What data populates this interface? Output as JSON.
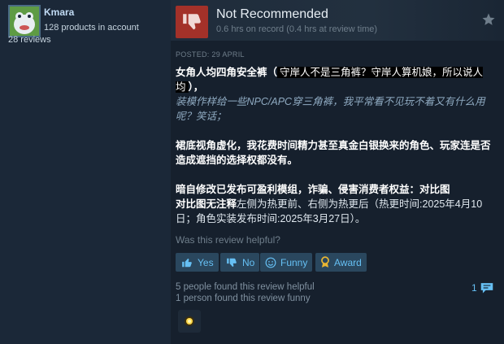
{
  "author": {
    "name": "Kmara",
    "products": "128 products in account",
    "reviews": "28 reviews"
  },
  "review": {
    "verdict": "Not Recommended",
    "hours": "0.6 hrs on record (0.4 hrs at review time)",
    "posted": "POSTED: 29 APRIL",
    "p1_a": "女角人均四角安全裤（",
    "p1_spoiler": "守岸人不是三角裤？守岸人算机娘，所以说人均",
    "p1_b": "），",
    "p2": "装模作样给一些NPC/APC穿三角裤，我平常看不见玩不着又有什么用呢？笑话；",
    "p3": "裙底视角虚化，我花费时间精力甚至真金白银换来的角色、玩家连是否造成遮挡的选择权都没有。",
    "p4_bold": "暗自修改已发布可盈利模组，诈骗、侵害消费者权益：对比图\n对比图无注释",
    "p4_rest": "左侧为热更前、右侧为热更后（热更时间:2025年4月10日；角色实装发布时间:2025年3月27日）。"
  },
  "feedback": {
    "question": "Was this review helpful?",
    "yes_label": "Yes",
    "no_label": "No",
    "funny_label": "Funny",
    "award_label": "Award",
    "helpful_stat": "5 people found this review helpful",
    "funny_stat": "1 person found this review funny",
    "comment_count": "1"
  },
  "icons": {
    "verdict": "thumbs-down-icon",
    "star": "star-icon",
    "yes": "thumbs-up-icon",
    "no": "thumbs-down-icon",
    "funny": "smiley-icon",
    "award": "award-icon",
    "comment": "comment-icon"
  },
  "colors": {
    "accent": "#66c0f4",
    "negative": "#a33129",
    "background": "#1b2838"
  }
}
